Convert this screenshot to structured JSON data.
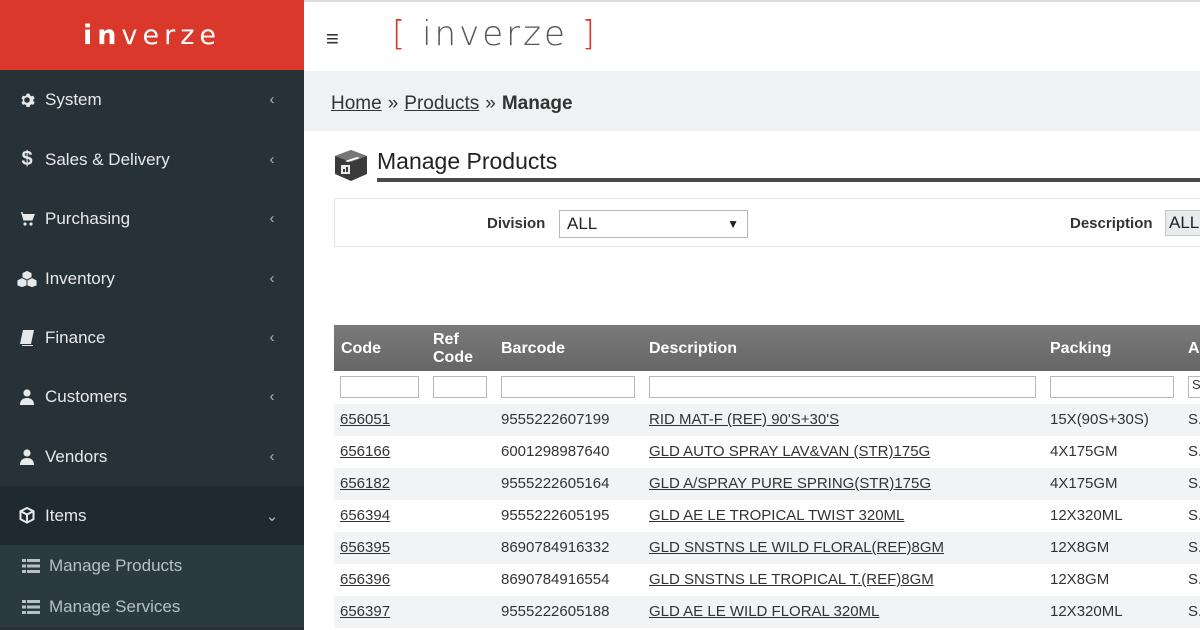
{
  "brand": {
    "bold": "in",
    "rest": "verze"
  },
  "topbar": {
    "logo_left": "[",
    "logo_text": "inverze",
    "logo_right": "]"
  },
  "sidebar": {
    "items": [
      {
        "label": "System",
        "icon": "gear-icon"
      },
      {
        "label": "Sales & Delivery",
        "icon": "dollar-icon"
      },
      {
        "label": "Purchasing",
        "icon": "cart-icon"
      },
      {
        "label": "Inventory",
        "icon": "cubes-icon"
      },
      {
        "label": "Finance",
        "icon": "book-icon"
      },
      {
        "label": "Customers",
        "icon": "user-icon"
      },
      {
        "label": "Vendors",
        "icon": "user-icon"
      },
      {
        "label": "Items",
        "icon": "cube-icon"
      }
    ],
    "subitems": [
      {
        "label": "Manage Products",
        "icon": "list-icon"
      },
      {
        "label": "Manage Services",
        "icon": "list-icon"
      }
    ]
  },
  "breadcrumb": {
    "home": "Home",
    "sep": "»",
    "products": "Products",
    "current": "Manage"
  },
  "page": {
    "title": "Manage Products"
  },
  "filters": {
    "division_label": "Division",
    "division_value": "ALL",
    "description_label": "Description",
    "description_value": "ALL"
  },
  "table": {
    "headers": {
      "code": "Code",
      "ref_code_1": "Ref",
      "ref_code_2": "Code",
      "barcode": "Barcode",
      "description": "Description",
      "packing": "Packing",
      "next": "A"
    },
    "filter_next_value": "S",
    "rows": [
      {
        "code": "656051",
        "barcode": "9555222607199",
        "description": "RID MAT-F (REF) 90'S+30'S",
        "packing": "15X(90S+30S)",
        "next": "S."
      },
      {
        "code": "656166",
        "barcode": "6001298987640",
        "description": "GLD AUTO SPRAY LAV&VAN (STR)175G",
        "packing": "4X175GM",
        "next": "S."
      },
      {
        "code": "656182",
        "barcode": "9555222605164",
        "description": "GLD A/SPRAY PURE SPRING(STR)175G",
        "packing": "4X175GM",
        "next": "S."
      },
      {
        "code": "656394",
        "barcode": "9555222605195",
        "description": "GLD AE LE TROPICAL TWIST 320ML",
        "packing": "12X320ML",
        "next": "S."
      },
      {
        "code": "656395",
        "barcode": "8690784916332",
        "description": "GLD SNSTNS LE WILD FLORAL(REF)8GM",
        "packing": "12X8GM",
        "next": "S."
      },
      {
        "code": "656396",
        "barcode": "8690784916554",
        "description": "GLD SNSTNS LE TROPICAL T.(REF)8GM",
        "packing": "12X8GM",
        "next": "S."
      },
      {
        "code": "656397",
        "barcode": "9555222605188",
        "description": "GLD AE LE WILD FLORAL 320ML",
        "packing": "12X320ML",
        "next": "S."
      }
    ]
  },
  "colors": {
    "brand": "#d9382a",
    "sidebar": "#263238",
    "header": "#6f6f6f"
  }
}
